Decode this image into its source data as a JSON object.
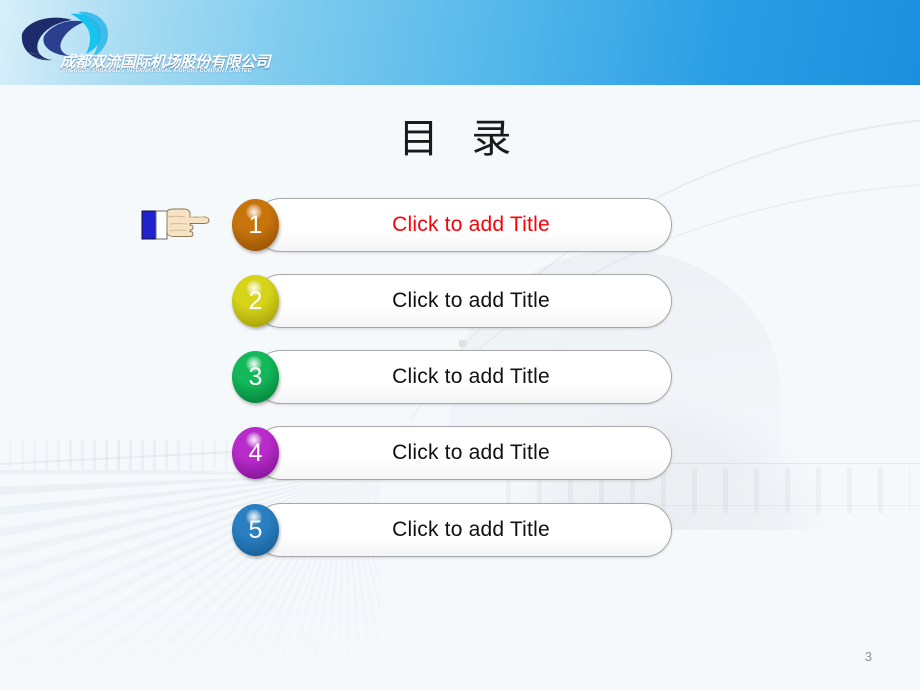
{
  "slide": {
    "page_number": "3",
    "background_color": "#f6f9fc"
  },
  "header": {
    "gradient_from": "#d9effa",
    "gradient_to": "#1b8fdd",
    "logo": {
      "icon_name": "airport-swoosh-logo",
      "company_name_cn": "成都双流国际机场股份有限公司",
      "company_name_en": "CHENGDU SHUANGLIU INTERNATIONAL AIRPORT COMPANY LIMITED",
      "mark_color_dark": "#1d2b6b",
      "mark_color_light": "#29b6e8"
    }
  },
  "title": {
    "text": "目  录"
  },
  "pointer": {
    "icon_name": "pointing-hand-icon",
    "cuff_color": "#2222cc",
    "skin_color": "#f7e3c4"
  },
  "contents": {
    "items": [
      {
        "number": "1",
        "label": "Click to add Title",
        "badge_color": "#c8740c",
        "badge_color_dark": "#8f4f04",
        "text_color": "#fb0007",
        "accent": true
      },
      {
        "number": "2",
        "label": "Click to add Title",
        "badge_color": "#d6d318",
        "badge_color_dark": "#9d9a0a",
        "text_color": "#101010",
        "accent": false
      },
      {
        "number": "3",
        "label": "Click to add Title",
        "badge_color": "#12b85a",
        "badge_color_dark": "#047a37",
        "text_color": "#101010",
        "accent": false
      },
      {
        "number": "4",
        "label": "Click to add Title",
        "badge_color": "#b72bc9",
        "badge_color_dark": "#7c1190",
        "text_color": "#101010",
        "accent": false
      },
      {
        "number": "5",
        "label": "Click to add Title",
        "badge_color": "#2a7fc0",
        "badge_color_dark": "#145a92",
        "text_color": "#101010",
        "accent": false
      }
    ],
    "row_border_color": "#a8a8a8",
    "row_fill_color": "#ffffff"
  }
}
